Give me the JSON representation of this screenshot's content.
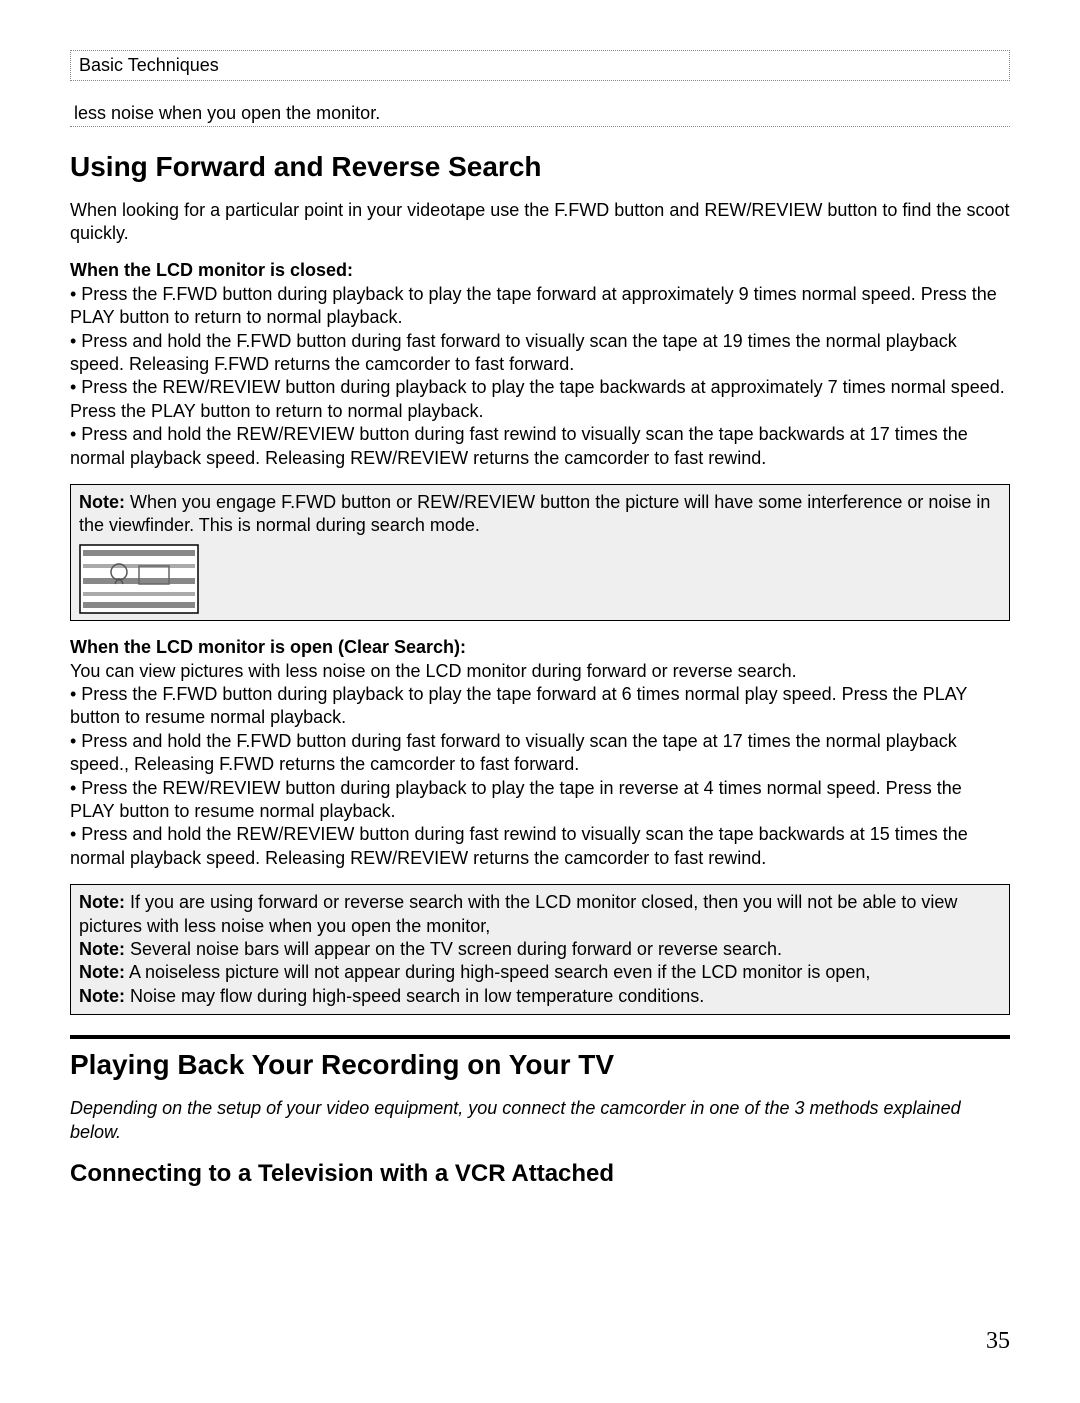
{
  "breadcrumb": "Basic Techniques",
  "carryover_line": "less noise when you open the monitor.",
  "section1": {
    "title": "Using Forward and Reverse Search",
    "intro": "When looking for a particular point in your videotape use the F.FWD button and REW/REVIEW button to find the scoot quickly.",
    "closed_head": "When the LCD monitor is closed:",
    "closed_bullets": "• Press the F.FWD button during playback to play the tape forward at approximately 9 times normal speed. Press the PLAY button to return to normal playback.\n• Press and hold the F.FWD button during fast forward to visually scan the tape at 19 times the normal playback speed. Releasing F.FWD returns the camcorder to fast forward.\n• Press the REW/REVIEW button during playback to play the tape backwards at approximately 7 times normal speed. Press the PLAY button to return to normal playback.\n• Press and hold the REW/REVIEW button during fast rewind to visually scan the tape backwards at 17 times the normal playback speed. Releasing REW/REVIEW returns the camcorder to fast rewind.",
    "note1_lead": "Note:",
    "note1_text": " When you engage F.FWD button or REW/REVIEW button the picture will have some interference or noise in the viewfinder. This is normal during search mode.",
    "open_head": "When the LCD monitor is open (Clear Search):",
    "open_bullets": "You can view pictures with less noise on the LCD monitor during forward or reverse search.\n• Press the F.FWD button during playback to play the tape forward at 6 times normal play speed. Press the PLAY button to resume normal playback.\n• Press and hold the F.FWD button during fast forward to visually scan the tape at 17 times the normal playback speed., Releasing F.FWD returns the camcorder to fast forward.\n• Press the REW/REVIEW button during playback to play the tape in reverse at 4 times normal speed. Press the PLAY button to resume normal playback.\n• Press and hold the REW/REVIEW button during fast rewind to visually scan the tape backwards at 15 times the normal playback speed. Releasing REW/REVIEW returns the camcorder to fast rewind.",
    "note2_l1_lead": "Note:",
    "note2_l1": " If you are using forward or reverse search with the LCD monitor closed, then you will not be able to view pictures with less noise when you open the monitor,",
    "note2_l2_lead": "Note:",
    "note2_l2": " Several noise bars will appear on the TV screen during forward or reverse search.",
    "note2_l3_lead": "Note:",
    "note2_l3": " A noiseless picture will not appear during high-speed search even if the LCD monitor is open,",
    "note2_l4_lead": "Note:",
    "note2_l4": " Noise may flow during high-speed search in low temperature conditions."
  },
  "section2": {
    "title": "Playing Back Your Recording on Your TV",
    "intro": "Depending on the setup of your video equipment, you connect the camcorder in one of the 3 methods explained below.",
    "subtitle": "Connecting to a Television with a VCR Attached"
  },
  "page_number": "35"
}
